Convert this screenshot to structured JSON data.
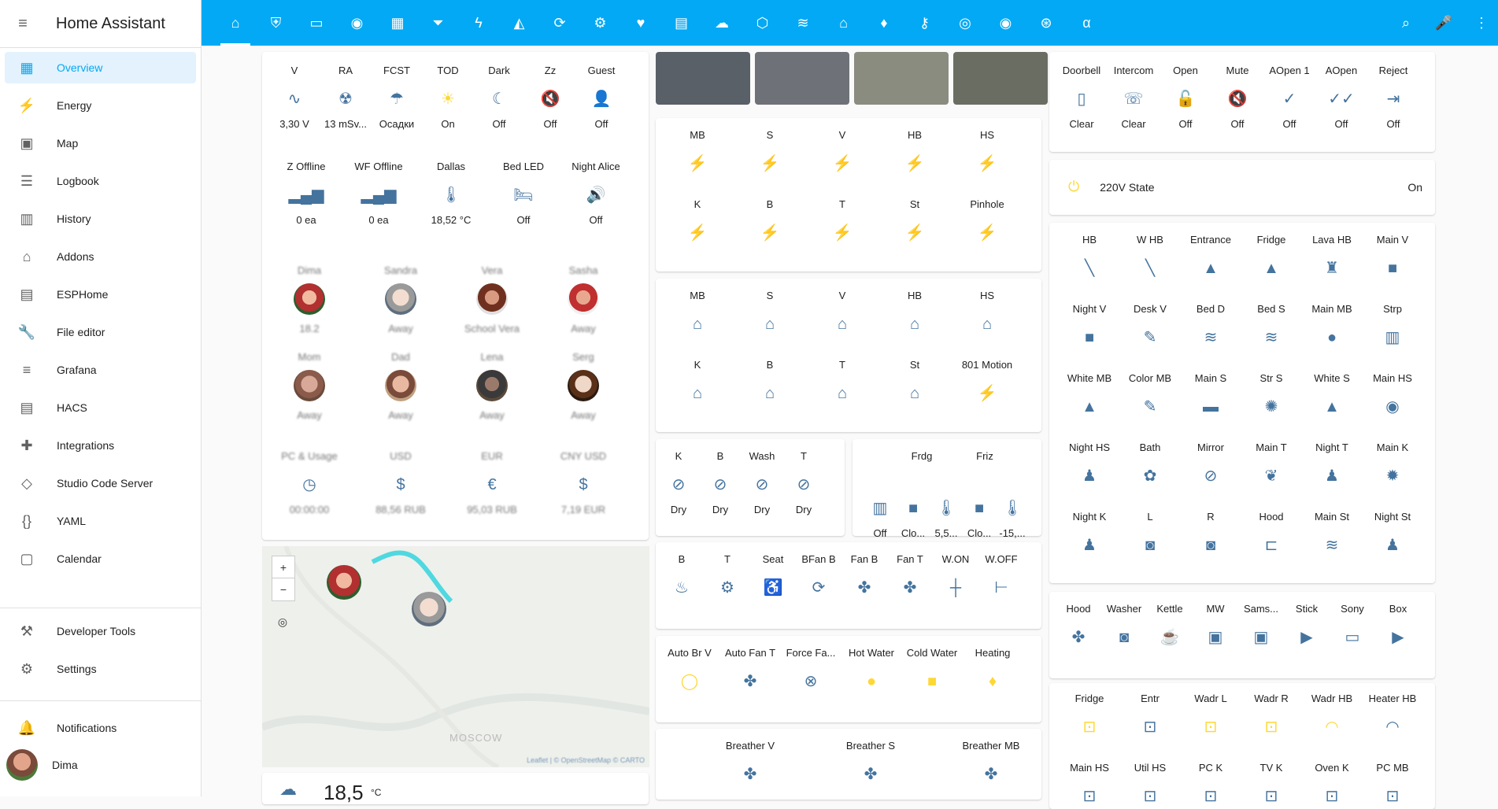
{
  "app": {
    "title": "Home Assistant"
  },
  "sidebar": {
    "items": [
      {
        "label": "Overview",
        "icon": "view-dashboard-icon",
        "glyph": "▦"
      },
      {
        "label": "Energy",
        "icon": "lightning-bolt-icon",
        "glyph": "⚡"
      },
      {
        "label": "Map",
        "icon": "account-box-icon",
        "glyph": "▣"
      },
      {
        "label": "Logbook",
        "icon": "format-list-bulleted-icon",
        "glyph": "☰"
      },
      {
        "label": "History",
        "icon": "chart-box-icon",
        "glyph": "▥"
      },
      {
        "label": "Addons",
        "icon": "home-assistant-icon",
        "glyph": "⌂"
      },
      {
        "label": "ESPHome",
        "icon": "chip-icon",
        "glyph": "▤"
      },
      {
        "label": "File editor",
        "icon": "wrench-icon",
        "glyph": "🔧"
      },
      {
        "label": "Grafana",
        "icon": "chart-timeline-icon",
        "glyph": "≡"
      },
      {
        "label": "HACS",
        "icon": "hacs-icon",
        "glyph": "▤"
      },
      {
        "label": "Integrations",
        "icon": "puzzle-icon",
        "glyph": "✚"
      },
      {
        "label": "Studio Code Server",
        "icon": "vscode-icon",
        "glyph": "◇"
      },
      {
        "label": "YAML",
        "icon": "code-braces-icon",
        "glyph": "{}"
      },
      {
        "label": "Calendar",
        "icon": "calendar-icon",
        "glyph": "▢"
      }
    ],
    "bottom": [
      {
        "label": "Developer Tools",
        "icon": "hammer-icon",
        "glyph": "⚒"
      },
      {
        "label": "Settings",
        "icon": "cog-icon",
        "glyph": "⚙"
      }
    ],
    "notifications": {
      "label": "Notifications",
      "icon": "bell-icon",
      "glyph": "🔔"
    },
    "user": {
      "label": "Dima"
    }
  },
  "topbar": {
    "views": [
      {
        "icon": "home-icon",
        "glyph": "⌂"
      },
      {
        "icon": "shield-icon",
        "glyph": "⛨"
      },
      {
        "icon": "rectangle-icon",
        "glyph": "▭"
      },
      {
        "icon": "record-circle-icon",
        "glyph": "◉"
      },
      {
        "icon": "floor-plan-icon",
        "glyph": "▦"
      },
      {
        "icon": "filter-icon",
        "glyph": "⏷"
      },
      {
        "icon": "flash-icon",
        "glyph": "ϟ"
      },
      {
        "icon": "robot-vacuum-icon",
        "glyph": "◭"
      },
      {
        "icon": "cog-refresh-icon",
        "glyph": "⟳"
      },
      {
        "icon": "cog-icon",
        "glyph": "⚙"
      },
      {
        "icon": "heart-pulse-icon",
        "glyph": "♥"
      },
      {
        "icon": "radio-icon",
        "glyph": "▤"
      },
      {
        "icon": "cloud-icon",
        "glyph": "☁"
      },
      {
        "icon": "esphome-icon",
        "glyph": "⬡"
      },
      {
        "icon": "wifi-cog-icon",
        "glyph": "≋"
      },
      {
        "icon": "home-automation-icon",
        "glyph": "⌂"
      },
      {
        "icon": "water-icon",
        "glyph": "♦"
      },
      {
        "icon": "key-icon",
        "glyph": "⚷"
      },
      {
        "icon": "radiobox-icon",
        "glyph": "◎"
      },
      {
        "icon": "access-point-icon",
        "glyph": "◉"
      },
      {
        "icon": "antenna-icon",
        "glyph": "⊛"
      },
      {
        "icon": "alpha-icon",
        "glyph": "α"
      }
    ],
    "actions": [
      {
        "icon": "magnify-icon",
        "glyph": "⌕"
      },
      {
        "icon": "microphone-icon",
        "glyph": "🎤"
      },
      {
        "icon": "dots-vertical-icon",
        "glyph": "⋮"
      }
    ]
  },
  "cards": {
    "status": [
      {
        "name": "V",
        "icon": "sine-wave-icon",
        "glyph": "∿",
        "state": "3,30 V"
      },
      {
        "name": "RA",
        "icon": "radioactive-icon",
        "glyph": "☢",
        "state": "13 mSv..."
      },
      {
        "name": "FCST",
        "icon": "weather-rainy-icon",
        "glyph": "☂",
        "state": "Осадки"
      },
      {
        "name": "TOD",
        "icon": "sun-icon",
        "glyph": "☀",
        "state": "On",
        "on": true
      },
      {
        "name": "Dark",
        "icon": "moon-icon",
        "glyph": "☾",
        "state": "Off"
      },
      {
        "name": "Zz",
        "icon": "volume-off-icon",
        "glyph": "🔇",
        "state": "Off"
      },
      {
        "name": "Guest",
        "icon": "account-question-icon",
        "glyph": "👤",
        "state": "Off"
      }
    ],
    "status2": [
      {
        "name": "Z Offline",
        "icon": "signal-icon",
        "glyph": "▂▄▆",
        "state": "0 ea"
      },
      {
        "name": "WF Offline",
        "icon": "signal-icon",
        "glyph": "▂▄▆",
        "state": "0 ea"
      },
      {
        "name": "Dallas",
        "icon": "thermometer-icon",
        "glyph": "🌡",
        "state": "18,52 °C"
      },
      {
        "name": "Bed LED",
        "icon": "bed-icon",
        "glyph": "🛏",
        "state": "Off"
      },
      {
        "name": "Night Alice",
        "icon": "volume-high-icon",
        "glyph": "🔊",
        "state": "Off"
      }
    ],
    "people": [
      {
        "name": "Dima",
        "state": "18.2",
        "face": "f1"
      },
      {
        "name": "Sandra",
        "state": "Away",
        "face": "f2"
      },
      {
        "name": "Vera",
        "state": "School Vera",
        "face": "f3"
      },
      {
        "name": "Sasha",
        "state": "Away",
        "face": "f4"
      },
      {
        "name": "Mom",
        "state": "Away",
        "face": "f5"
      },
      {
        "name": "Dad",
        "state": "Away",
        "face": "f6"
      },
      {
        "name": "Lena",
        "state": "Away",
        "face": "f7"
      },
      {
        "name": "Serg",
        "state": "Away",
        "face": "f8"
      }
    ],
    "money": [
      {
        "name": "PC & Usage",
        "icon": "clock-icon",
        "glyph": "◷",
        "state": "00:00:00"
      },
      {
        "name": "USD",
        "icon": "currency-usd-icon",
        "glyph": "$",
        "state": "88,56 RUB"
      },
      {
        "name": "EUR",
        "icon": "currency-eur-icon",
        "glyph": "€",
        "state": "95,03 RUB"
      },
      {
        "name": "CNY USD",
        "icon": "currency-usd-icon",
        "glyph": "$",
        "state": "7,19 EUR"
      }
    ],
    "map": {
      "city": "MOSCOW",
      "attribution": "Leaflet | © OpenStreetMap © CARTO"
    },
    "weather": {
      "temp": "18,5",
      "unit": "°C"
    },
    "cameras": [
      {
        "color": "#5a6068"
      },
      {
        "color": "#6e7278"
      },
      {
        "color": "#8a8c80"
      },
      {
        "color": "#6a6e62"
      }
    ],
    "motion1": [
      {
        "name": "MB"
      },
      {
        "name": "S"
      },
      {
        "name": "V"
      },
      {
        "name": "HB"
      },
      {
        "name": "HS"
      },
      {
        "name": "K"
      },
      {
        "name": "B"
      },
      {
        "name": "T"
      },
      {
        "name": "St"
      },
      {
        "name": "Pinhole"
      }
    ],
    "motion2": [
      {
        "name": "MB",
        "glyph": "⌂"
      },
      {
        "name": "S",
        "glyph": "⌂"
      },
      {
        "name": "V",
        "glyph": "⌂"
      },
      {
        "name": "HB",
        "glyph": "⌂"
      },
      {
        "name": "HS",
        "glyph": "⌂"
      },
      {
        "name": "K",
        "glyph": "⌂"
      },
      {
        "name": "B",
        "glyph": "⌂"
      },
      {
        "name": "T",
        "glyph": "⌂"
      },
      {
        "name": "St",
        "glyph": "⌂"
      },
      {
        "name": "801 Motion",
        "glyph": "⚡"
      }
    ],
    "leaks": [
      {
        "name": "K",
        "state": "Dry"
      },
      {
        "name": "B",
        "state": "Dry"
      },
      {
        "name": "Wash",
        "state": "Dry"
      },
      {
        "name": "T",
        "state": "Dry"
      }
    ],
    "fridge": [
      {
        "glyph": "▥",
        "state": "Off"
      },
      {
        "glyph": "■",
        "state": "Clo..."
      },
      {
        "glyph": "🌡",
        "state": "5,5..."
      },
      {
        "glyph": "■",
        "state": "Clo..."
      },
      {
        "glyph": "🌡",
        "state": "-15,..."
      }
    ],
    "fridge_headers": [
      "Frdg",
      "Friz"
    ],
    "fans": [
      {
        "name": "B",
        "glyph": "♨"
      },
      {
        "name": "T",
        "glyph": "⚙"
      },
      {
        "name": "Seat",
        "glyph": "♿"
      },
      {
        "name": "BFan B",
        "glyph": "⟳"
      },
      {
        "name": "Fan B",
        "glyph": "✤"
      },
      {
        "name": "Fan T",
        "glyph": "✤"
      },
      {
        "name": "W.ON",
        "glyph": "┼"
      },
      {
        "name": "W.OFF",
        "glyph": "⊢"
      }
    ],
    "auto": [
      {
        "name": "Auto Br V",
        "glyph": "◯",
        "on": true
      },
      {
        "name": "Auto Fan T",
        "glyph": "✤"
      },
      {
        "name": "Force Fa...",
        "glyph": "⊗"
      },
      {
        "name": "Hot Water",
        "glyph": "●",
        "on": true
      },
      {
        "name": "Cold Water",
        "glyph": "■",
        "on": true
      },
      {
        "name": "Heating",
        "glyph": "♦",
        "on": true
      }
    ],
    "breathers": [
      {
        "name": "Breather V"
      },
      {
        "name": "Breather S"
      },
      {
        "name": "Breather MB"
      }
    ],
    "door": [
      {
        "name": "Doorbell",
        "glyph": "▯",
        "state": "Clear"
      },
      {
        "name": "Intercom",
        "glyph": "☏",
        "state": "Clear"
      },
      {
        "name": "Open",
        "glyph": "🔓",
        "state": "Off"
      },
      {
        "name": "Mute",
        "glyph": "🔇",
        "state": "Off"
      },
      {
        "name": "AOpen 1",
        "glyph": "✓",
        "state": "Off"
      },
      {
        "name": "AOpen",
        "glyph": "✓✓",
        "state": "Off"
      },
      {
        "name": "Reject",
        "glyph": "⇥",
        "state": "Off"
      }
    ],
    "power": {
      "name": "220V State",
      "state": "On"
    },
    "lights": [
      {
        "name": "HB",
        "glyph": "╲"
      },
      {
        "name": "W HB",
        "glyph": "╲"
      },
      {
        "name": "Entrance",
        "glyph": "▲"
      },
      {
        "name": "Fridge",
        "glyph": "▲"
      },
      {
        "name": "Lava HB",
        "glyph": "♜"
      },
      {
        "name": "Main V",
        "glyph": "■"
      },
      {
        "name": "Night V",
        "glyph": "■"
      },
      {
        "name": "Desk V",
        "glyph": "✎"
      },
      {
        "name": "Bed D",
        "glyph": "≋"
      },
      {
        "name": "Bed S",
        "glyph": "≋"
      },
      {
        "name": "Main MB",
        "glyph": "●"
      },
      {
        "name": "Strp",
        "glyph": "▥"
      },
      {
        "name": "White MB",
        "glyph": "▲"
      },
      {
        "name": "Color MB",
        "glyph": "✎"
      },
      {
        "name": "Main S",
        "glyph": "▬"
      },
      {
        "name": "Str S",
        "glyph": "✺"
      },
      {
        "name": "White S",
        "glyph": "▲"
      },
      {
        "name": "Main HS",
        "glyph": "◉"
      },
      {
        "name": "Night HS",
        "glyph": "♟"
      },
      {
        "name": "Bath",
        "glyph": "✿"
      },
      {
        "name": "Mirror",
        "glyph": "⊘"
      },
      {
        "name": "Main T",
        "glyph": "❦"
      },
      {
        "name": "Night T",
        "glyph": "♟"
      },
      {
        "name": "Main K",
        "glyph": "✹"
      },
      {
        "name": "Night K",
        "glyph": "♟"
      },
      {
        "name": "L",
        "glyph": "◙"
      },
      {
        "name": "R",
        "glyph": "◙"
      },
      {
        "name": "Hood",
        "glyph": "⊏"
      },
      {
        "name": "Main St",
        "glyph": "≋"
      },
      {
        "name": "Night St",
        "glyph": "♟"
      }
    ],
    "media": [
      {
        "name": "Hood",
        "glyph": "✤"
      },
      {
        "name": "Washer",
        "glyph": "◙"
      },
      {
        "name": "Kettle",
        "glyph": "☕"
      },
      {
        "name": "MW",
        "glyph": "▣"
      },
      {
        "name": "Sams...",
        "glyph": "▣"
      },
      {
        "name": "Stick",
        "glyph": "▶"
      },
      {
        "name": "Sony",
        "glyph": "▭"
      },
      {
        "name": "Box",
        "glyph": "▶"
      }
    ],
    "outlets": [
      {
        "name": "Fridge",
        "glyph": "⊡",
        "on": true
      },
      {
        "name": "Entr",
        "glyph": "⊡"
      },
      {
        "name": "Wadr L",
        "glyph": "⊡",
        "on": true
      },
      {
        "name": "Wadr R",
        "glyph": "⊡",
        "on": true
      },
      {
        "name": "Wadr HB",
        "glyph": "◠",
        "on": true
      },
      {
        "name": "Heater HB",
        "glyph": "◠"
      },
      {
        "name": "Main HS"
      },
      {
        "name": "Util HS"
      },
      {
        "name": "PC K"
      },
      {
        "name": "TV K"
      },
      {
        "name": "Oven K"
      },
      {
        "name": "PC MB"
      }
    ]
  },
  "colors": {
    "primary": "#03a9f4",
    "icon": "#44739e",
    "active": "#fdd835",
    "sidebar_active_bg": "#e3f2fd"
  }
}
